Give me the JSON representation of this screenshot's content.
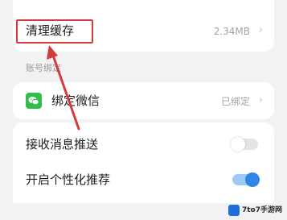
{
  "settings": {
    "clear_cache": {
      "label": "清理缓存",
      "value": "2.34MB",
      "chevron": "›"
    },
    "account_section_label": "账号绑定",
    "wechat": {
      "icon": "wechat-icon",
      "label": "绑定微信",
      "status": "已绑定",
      "chevron": "›"
    },
    "push_notifications": {
      "label": "接收消息推送",
      "enabled": false
    },
    "personalized_recommendations": {
      "label": "开启个性化推荐",
      "enabled": true
    }
  },
  "annotation": {
    "box_color": "#d63b3b",
    "arrow_color": "#d63b3b"
  },
  "watermark": {
    "text": "7to7手游网"
  },
  "colors": {
    "toggle_on_accent": "#2f86e6",
    "wechat_green": "#2fbf4a"
  }
}
